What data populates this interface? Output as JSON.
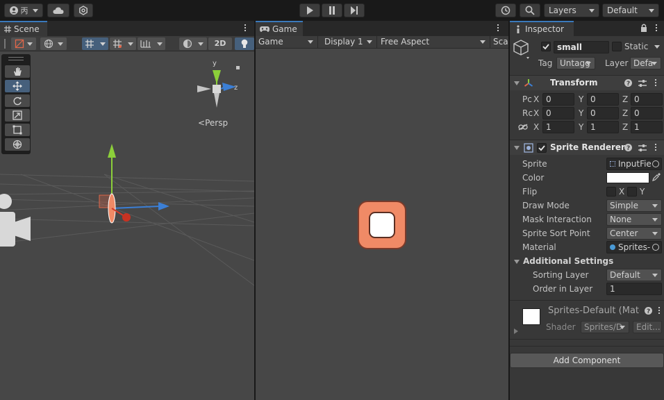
{
  "toolbar": {
    "account_label": "",
    "layers_label": "Layers",
    "layout_label": "Default"
  },
  "scene": {
    "tab_label": "Scene",
    "btn_2d": "2D",
    "persp_label": "Persp",
    "gizmo_y": "y",
    "gizmo_z": "z"
  },
  "game": {
    "tab_label": "Game",
    "mode": "Game",
    "display": "Display 1",
    "aspect": "Free Aspect",
    "scale_label": "Sca"
  },
  "inspector": {
    "tab_label": "Inspector",
    "object_name": "small",
    "static_label": "Static",
    "tag_label": "Tag",
    "tag_value": "Untagg",
    "layer_label": "Layer",
    "layer_value": "Defa",
    "transform": {
      "title": "Transform",
      "rows": [
        {
          "label": "Pc",
          "x_label": "X",
          "x": "0",
          "y_label": "Y",
          "y": "0",
          "z_label": "Z",
          "z": "0"
        },
        {
          "label": "Rc",
          "x_label": "X",
          "x": "0",
          "y_label": "Y",
          "y": "0",
          "z_label": "Z",
          "z": "0"
        },
        {
          "label": "",
          "x_label": "X",
          "x": "1",
          "y_label": "Y",
          "y": "1",
          "z_label": "Z",
          "z": "1"
        }
      ]
    },
    "sprite_renderer": {
      "title": "Sprite Renderer",
      "sprite_label": "Sprite",
      "sprite_value": "InputFie",
      "color_label": "Color",
      "color_value": "#ffffff",
      "flip_label": "Flip",
      "flip_x": "X",
      "flip_y": "Y",
      "draw_mode_label": "Draw Mode",
      "draw_mode_value": "Simple",
      "mask_label": "Mask Interaction",
      "mask_value": "None",
      "sort_point_label": "Sprite Sort Point",
      "sort_point_value": "Center",
      "material_label": "Material",
      "material_value": "Sprites-",
      "additional_label": "Additional Settings",
      "sorting_layer_label": "Sorting Layer",
      "sorting_layer_value": "Default",
      "order_label": "Order in Layer",
      "order_value": "1"
    },
    "material": {
      "title": "Sprites-Default (Mate",
      "shader_label": "Shader",
      "shader_value": "Sprites/D",
      "edit_label": "Edit..."
    },
    "add_component": "Add Component"
  },
  "colors": {
    "accent": "#3a79bb",
    "sprite_orange": "#f08a66",
    "panel_bg": "#383838",
    "game_bg": "#474747",
    "scene_bg": "#474747"
  }
}
